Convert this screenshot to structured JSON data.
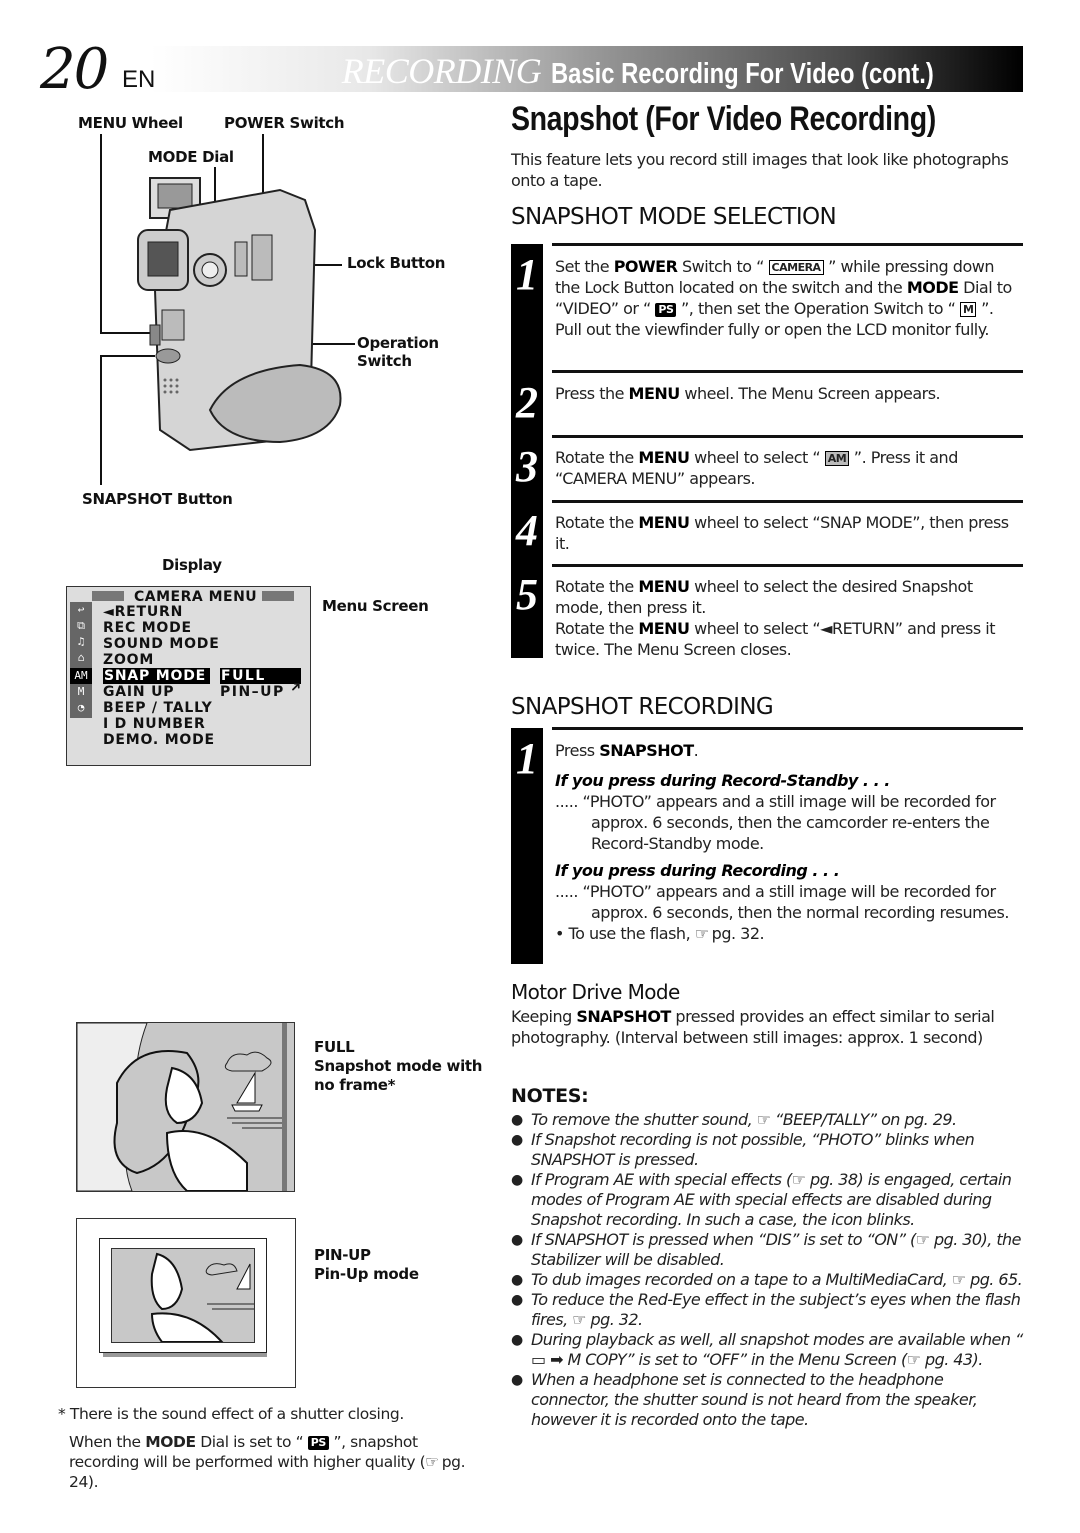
{
  "header": {
    "page_number": "20",
    "language": "EN",
    "section": "RECORDING",
    "subtitle": "Basic Recording For Video (cont.)"
  },
  "diagram": {
    "labels": {
      "menu_wheel": "MENU Wheel",
      "power_switch": "POWER Switch",
      "mode_dial": "MODE Dial",
      "lock_button": "Lock Button",
      "operation_switch_1": "Operation",
      "operation_switch_2": "Switch",
      "snapshot_button": "SNAPSHOT Button"
    },
    "display_label": "Display",
    "menu_screen_label": "Menu Screen"
  },
  "menu_screen": {
    "title": "CAMERA  MENU",
    "items": [
      "◄RETURN",
      "REC  MODE",
      "SOUND  MODE",
      "ZOOM",
      "SNAP  MODE",
      "GAIN  UP",
      "BEEP / TALLY",
      "I D  NUMBER",
      "DEMO.  MODE"
    ],
    "selected_item": "SNAP  MODE",
    "options": [
      "FULL",
      "PIN–UP"
    ],
    "selected_option": "FULL",
    "side_icons": [
      "return-icon",
      "rec-mode-icon",
      "sound-icon",
      "zoom-icon",
      "am-camera-icon",
      "m-manual-icon",
      "clock-icon"
    ],
    "side_icon_glyphs": [
      "↩",
      "⧉",
      "♫",
      "⌂",
      "AM",
      "M",
      "◔"
    ]
  },
  "illustrations": {
    "full": {
      "title": "FULL",
      "desc1": "Snapshot mode with",
      "desc2": "no frame*"
    },
    "pinup": {
      "title": "PIN-UP",
      "desc": "Pin-Up mode"
    }
  },
  "footnote": {
    "asterisk": "* There is the sound effect of a shutter closing.",
    "mode_note_pre": "When the ",
    "mode_note_bold": "MODE",
    "mode_note_mid": " Dial is set to “ ",
    "mode_note_icon": "PS",
    "mode_note_post": " ”, snapshot recording will be performed with higher quality (",
    "mode_note_ref": "☞",
    "mode_note_end": " pg. 24)."
  },
  "main": {
    "title": "Snapshot (For Video Recording)",
    "intro": "This feature lets you record still images that look like photographs onto a tape.",
    "mode_selection": {
      "heading": "SNAPSHOT MODE SELECTION",
      "steps": [
        {
          "num": "1",
          "parts": [
            "Set the ",
            "POWER",
            " Switch to “ ",
            "CAMERA",
            " ” while pressing down the Lock Button located on the switch and the ",
            "MODE",
            " Dial to “VIDEO” or “ ",
            "PS",
            " ”, then set the Operation Switch to “ ",
            "M",
            " ”. Pull out the viewfinder fully or open the LCD monitor fully."
          ]
        },
        {
          "num": "2",
          "parts": [
            "Press the ",
            "MENU",
            " wheel. The Menu Screen appears."
          ]
        },
        {
          "num": "3",
          "parts": [
            "Rotate the ",
            "MENU",
            " wheel to select “ ",
            "AM",
            " ”.  Press it and “CAMERA MENU” appears."
          ]
        },
        {
          "num": "4",
          "parts": [
            "Rotate the ",
            "MENU",
            " wheel to select “SNAP MODE”, then press it."
          ]
        },
        {
          "num": "5",
          "parts": [
            "Rotate the ",
            "MENU",
            " wheel to select the desired Snapshot mode, then press it.",
            "Rotate the ",
            "MENU",
            " wheel to select “◄RETURN” and press it twice. The Menu Screen closes."
          ]
        }
      ]
    },
    "recording": {
      "heading": "SNAPSHOT RECORDING",
      "step_num": "1",
      "press_pre": "Press ",
      "press_bold": "SNAPSHOT",
      "press_post": ".",
      "standby_head": "If you press during Record-Standby . . .",
      "standby_text": "..... “PHOTO” appears and a still image will be recorded for approx. 6 seconds, then the camcorder re-enters the Record-Standby mode.",
      "recording_head": "If you press during Recording . . .",
      "recording_text": "..... “PHOTO” appears and a still image will be recorded for approx. 6 seconds, then the normal recording resumes.",
      "flash_pre": "• To use the flash, ",
      "flash_ref": "☞",
      "flash_post": " pg. 32."
    },
    "motor_drive": {
      "heading": "Motor Drive Mode",
      "text_pre": "Keeping ",
      "text_bold": "SNAPSHOT",
      "text_post": " pressed provides an effect similar to serial photography. (Interval between still images: approx. 1 second)"
    },
    "notes": {
      "heading": "NOTES:",
      "items": [
        "To remove the shutter sound, ☞ “BEEP/TALLY” on pg. 29.",
        "If Snapshot recording is not possible, “PHOTO” blinks when SNAPSHOT is pressed.",
        "If Program AE with special effects (☞ pg. 38) is engaged, certain modes of Program AE with special effects are disabled during Snapshot recording. In such a case, the icon blinks.",
        "If SNAPSHOT is pressed when “DIS” is set to “ON” (☞ pg. 30), the Stabilizer will be disabled.",
        "To dub images recorded on a tape to a MultiMediaCard, ☞ pg. 65.",
        "To reduce the Red-Eye effect in the subject’s eyes when the flash fires, ☞ pg. 32.",
        "During playback as well, all snapshot modes are available when “ ▭ ➡ M  COPY” is set to “OFF” in the Menu Screen (☞ pg. 43).",
        "When a headphone set is connected to the headphone connector, the shutter sound is not heard from the speaker, however it is recorded onto the tape."
      ]
    }
  }
}
